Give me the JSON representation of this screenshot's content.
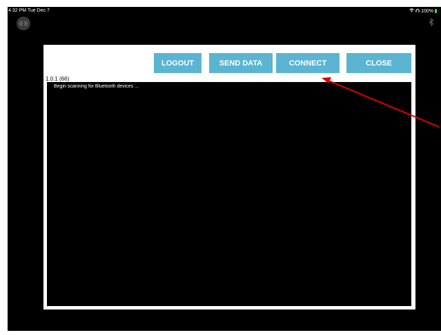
{
  "status_bar": {
    "time": "4:32 PM  Tue Dec 7",
    "battery": "100%"
  },
  "icons": {
    "radio": "radio-signal-icon",
    "bluetooth": "bluetooth-icon",
    "wifi": "wifi-icon",
    "headphones": "headphones-icon",
    "battery": "battery-icon"
  },
  "toolbar": {
    "logout": "LOGOUT",
    "send_data": "SEND DATA",
    "connect": "CONNECT",
    "close": "CLOSE"
  },
  "app": {
    "version": "1.0.1 (66)"
  },
  "console": {
    "line1": "Begin scanning for Bluetooth devices ..."
  },
  "colors": {
    "button": "#5bb4d1",
    "annotation_arrow": "#e00000"
  }
}
